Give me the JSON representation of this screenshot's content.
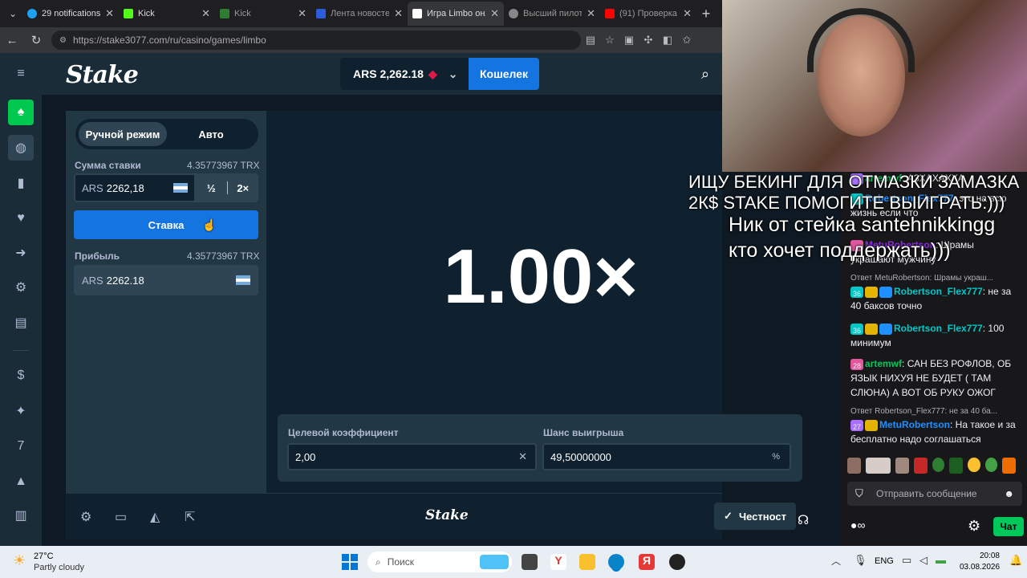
{
  "browser": {
    "tabs": [
      {
        "title": "29 notifications",
        "color": "#1da1f2"
      },
      {
        "title": "Kick",
        "color": "#53fc18"
      },
      {
        "title": "Kick",
        "color": "#53fc18"
      },
      {
        "title": "Лента новостей",
        "color": "#2a5cdb"
      },
      {
        "title": "Игра Limbo онл",
        "color": "#ffffff"
      },
      {
        "title": "Высший пилота",
        "color": "#888888"
      },
      {
        "title": "(91) Проверка",
        "color": "#ff0000"
      }
    ],
    "url": "https://stake3077.com/ru/casino/games/limbo"
  },
  "site": {
    "logo": "Stake",
    "balance": "ARS 2,262.18",
    "wallet_label": "Кошелек"
  },
  "bet": {
    "mode_manual": "Ручной режим",
    "mode_auto": "Авто",
    "amount_label": "Сумма ставки",
    "amount_crypto": "4.35773967 TRX",
    "currency": "ARS",
    "amount_value": "2262,18",
    "half": "½",
    "double": "2×",
    "bet_button": "Ставка",
    "profit_label": "Прибыль",
    "profit_crypto": "4.35773967 TRX",
    "profit_value": "2262.18"
  },
  "game": {
    "multiplier": "1.00×",
    "target_label": "Целевой коэффициент",
    "target_value": "2,00",
    "chance_label": "Шанс выигрыша",
    "chance_value": "49,50000000",
    "chance_unit": "%",
    "footer_logo": "Stake",
    "fairness": "Честност"
  },
  "overlay": {
    "line1": "ИЩУ БЕКИНГ ДЛЯ ОТМАЗКИ ЗАМАЗКА",
    "line2": "2К$ STAKE ПОМОГИТЕ ВЫИГРАТЬ:)))",
    "line3": "Ник от стейка santehnikkingg",
    "line4": "кто хочет поддержать)))"
  },
  "chat": {
    "messages": [
      {
        "user": "artemwf",
        "text": "АЗХАХАХХА",
        "color": "#00c85a"
      },
      {
        "user": "Robertson_Flex777",
        "text": "это на всю жизнь если что",
        "color": "#1e90ff"
      },
      {
        "user": "MetuRobertson",
        "text": "Шрамы украшают мужчину",
        "color": "#8a2be2"
      },
      {
        "user": "Robertson_Flex777",
        "text": "не за 40 баксов точно",
        "color": "#00c8c8"
      },
      {
        "user": "Robertson_Flex777",
        "text": "100 минимум",
        "color": "#00c8c8"
      },
      {
        "user": "artemwf",
        "text": "САН БЕЗ РОФЛОВ, ОБ ЯЗЫК НИХУЯ НЕ БУДЕТ ( ТАМ СЛЮНА) А ВОТ ОБ РУКУ ОЖОГ",
        "color": "#00c85a"
      },
      {
        "user": "MetuRobertson",
        "text": "На такое и за бесплатно надо соглашаться",
        "color": "#1e90ff"
      }
    ],
    "replies": [
      "Ответ MetuRobertson: Шрамы украш...",
      "Ответ Robertson_Flex777: не за 40 ба..."
    ],
    "badges": [
      "36",
      "36",
      "28",
      "27"
    ],
    "input_placeholder": "Отправить сообщение",
    "chat_button": "Чат"
  },
  "taskbar": {
    "weather_temp": "27°C",
    "weather_desc": "Partly cloudy",
    "search_placeholder": "Поиск",
    "lang": "ENG",
    "time": "20:08",
    "date": "03.08.2026"
  }
}
